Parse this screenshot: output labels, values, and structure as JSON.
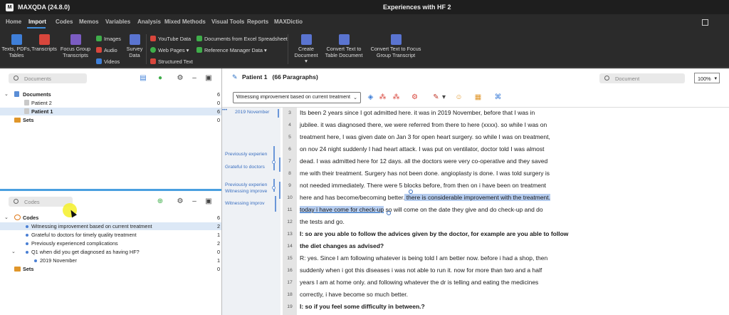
{
  "app": {
    "name": "MAXQDA (24.8.0)",
    "icon_letter": "M",
    "project_title": "Experiences with HF 2"
  },
  "menu": {
    "tabs": [
      "Home",
      "Import",
      "Codes",
      "Memos",
      "Variables",
      "Analysis",
      "Mixed Methods",
      "Visual Tools",
      "Reports",
      "MAXDictio"
    ],
    "active_tab": "Import"
  },
  "ribbon": {
    "texts_pdfs": [
      "Texts, PDFs,",
      "Tables"
    ],
    "transcripts": [
      "Transcripts"
    ],
    "focus_group": [
      "Focus Group",
      "Transcripts"
    ],
    "images": "Images",
    "audio": "Audio",
    "videos": "Videos",
    "survey_data": [
      "Survey",
      "Data"
    ],
    "youtube_data": "YouTube Data",
    "web_pages": "Web Pages",
    "structured_text": "Structured Text",
    "documents_excel": "Documents from Excel Spreadsheet",
    "reference_manager": "Reference Manager Data",
    "create_document": [
      "Create",
      "Document"
    ],
    "convert_table": [
      "Convert Text to",
      "Table Document"
    ],
    "convert_focus": [
      "Convert Text to Focus",
      "Group Transcript"
    ],
    "colors": {
      "blue": "#3f7fd8",
      "red": "#d8463c",
      "green": "#3fae4a",
      "purple": "#7b5cc2",
      "orange": "#e08a2a"
    }
  },
  "document_system": {
    "search_placeholder": "Documents",
    "rows": [
      {
        "label": "Documents",
        "count": "6"
      },
      {
        "label": "Patient 2",
        "count": "0"
      },
      {
        "label": "Patient 1",
        "count": "6"
      },
      {
        "label": "Sets",
        "count": "0"
      }
    ]
  },
  "code_system": {
    "search_placeholder": "Codes",
    "rows": [
      {
        "label": "Codes",
        "count": "6"
      },
      {
        "label": "Witnessing improvement based on current treatment",
        "count": "2"
      },
      {
        "label": "Grateful to doctors for timely quality treatment",
        "count": "1"
      },
      {
        "label": "Previously experienced complications",
        "count": "2"
      },
      {
        "label": "Q1 when did you get diagnosed as having HF?",
        "count": "0"
      },
      {
        "label": "2019 November",
        "count": "1"
      },
      {
        "label": "Sets",
        "count": "0"
      }
    ]
  },
  "document_browser": {
    "title": "Patient 1",
    "paragraphs": "(66 Paragraphs)",
    "search_placeholder": "Document",
    "zoom": "100%",
    "zoom_arrow": "▾",
    "code_select": "Witnessing improvement based on current treatment",
    "stripes": [
      {
        "label": "2019 November"
      },
      {
        "label": "Previously experien"
      },
      {
        "label": "Grateful to doctors"
      },
      {
        "label": "Previously experien"
      },
      {
        "label": "Witnessing improve"
      },
      {
        "label": "Witnessing improv"
      }
    ],
    "lines": [
      {
        "n": "3",
        "text": "Its been 2 years since I got admitted here. it was in 2019 November, before that I was in"
      },
      {
        "n": "4",
        "text": "jubilee. it was diagnosed there, we were referred from there to here (xxxx). so while I was on"
      },
      {
        "n": "5",
        "text": "treatment here, I was given date on Jan 3 for open heart surgery. so while I was on treatment,"
      },
      {
        "n": "6",
        "text": "on nov 24 night suddenly I had heart attack. I was put on ventilator, doctor told I was almost"
      },
      {
        "n": "7",
        "text": "dead. I was admitted here for 12 days. all the doctors were very co-operative and they saved"
      },
      {
        "n": "8",
        "text": "me with their treatment. Surgery has not been done. angioplasty is done. I was told surgery is"
      },
      {
        "n": "9",
        "text": "not needed immediately. There were 5 blocks before, from then on i have been on treatment"
      },
      {
        "n": "10",
        "pre": "here and has become/becoming better.",
        "hl": " there is considerable improvement with the treatment."
      },
      {
        "n": "11",
        "hl": "today i have come for check-up",
        "post": " so will come on the date they give and do check-up and do"
      },
      {
        "n": "12",
        "text": "the tests and go."
      },
      {
        "n": "13",
        "text": "I: so are you able to follow the advices given by the doctor, for example are you able to follow",
        "bold": true
      },
      {
        "n": "14",
        "text": "the diet changes as advised?",
        "bold": true
      },
      {
        "n": "15",
        "text": "R: yes. Since I am following whatever is being told I am better now. before i had a shop, then"
      },
      {
        "n": "16",
        "text": "suddenly when i got this diseases i was not able to run it. now for more than two and a half"
      },
      {
        "n": "17",
        "text": "years I am at home only. and following whatever the dr is telling and eating the medicines"
      },
      {
        "n": "18",
        "text": "correctly, i have become so much better."
      },
      {
        "n": "19",
        "text": "I: so if you feel some difficulty in between.?",
        "bold": true
      }
    ]
  }
}
